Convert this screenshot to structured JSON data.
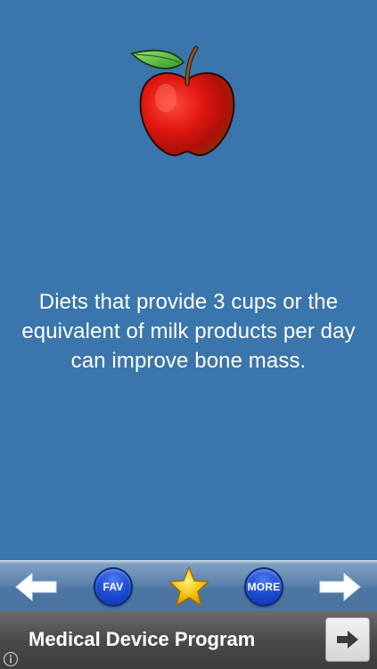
{
  "fact": {
    "text": "Diets that provide 3 cups or the equivalent of milk products per day can improve bone mass."
  },
  "toolbar": {
    "previous_icon": "left-arrow-icon",
    "fav_label": "FAV",
    "favorite_icon": "star-icon",
    "more_label": "MORE",
    "next_icon": "right-arrow-icon"
  },
  "ad": {
    "title": "Medical Device Program",
    "go_icon": "right-arrow-icon",
    "info_icon": "info-icon"
  },
  "colors": {
    "background": "#3a75ac",
    "button_blue": "#1f4fd6",
    "star": "#f5c518",
    "ad_background": "#4a4a4a"
  }
}
